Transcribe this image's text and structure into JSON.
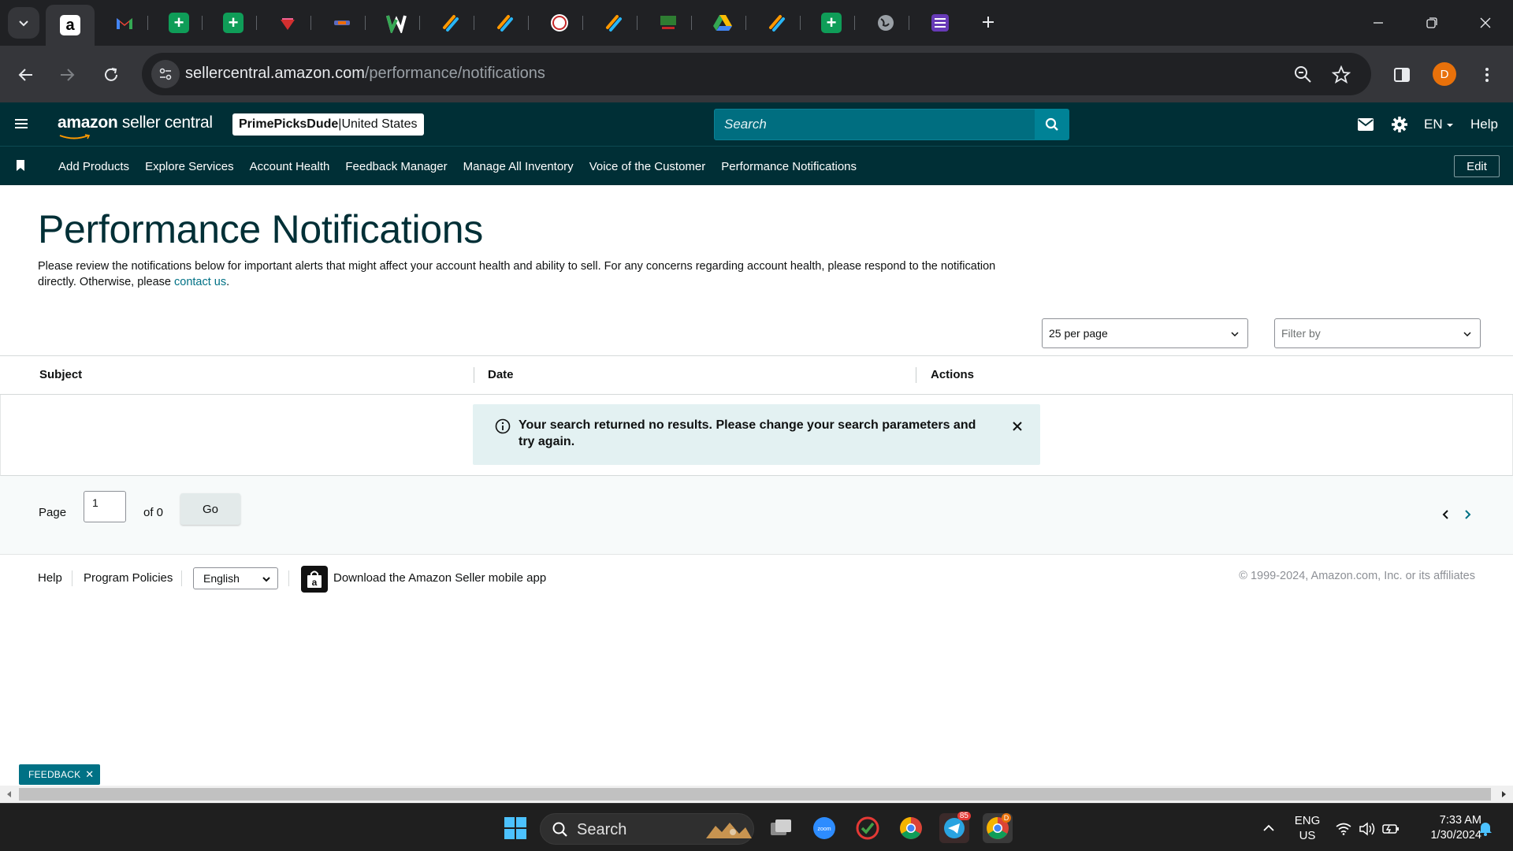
{
  "browser": {
    "url_host": "sellercentral.amazon.com",
    "url_path": "/performance/notifications",
    "profile_initial": "D",
    "tabs": [
      {
        "icon": "amazon-icon",
        "active": true
      },
      {
        "icon": "gmail-icon"
      },
      {
        "icon": "sheets-icon"
      },
      {
        "icon": "sheets-icon"
      },
      {
        "icon": "red-logo-icon"
      },
      {
        "icon": "purple-logo-icon"
      },
      {
        "icon": "w-logo-icon"
      },
      {
        "icon": "orange-stripes-icon"
      },
      {
        "icon": "orange-stripes-icon"
      },
      {
        "icon": "round-logo-icon"
      },
      {
        "icon": "orange-stripes-icon"
      },
      {
        "icon": "us-foods-icon"
      },
      {
        "icon": "drive-icon"
      },
      {
        "icon": "orange-stripes-icon"
      },
      {
        "icon": "sheets-icon"
      },
      {
        "icon": "globe-icon"
      },
      {
        "icon": "list-icon"
      }
    ]
  },
  "header": {
    "logo_bold": "amazon",
    "logo_rest": " seller central",
    "store_name": "PrimePicksDude",
    "store_sep": " | ",
    "store_region": "United States",
    "search_placeholder": "Search",
    "language": "EN",
    "help": "Help"
  },
  "nav": {
    "links": [
      "Add Products",
      "Explore Services",
      "Account Health",
      "Feedback Manager",
      "Manage All Inventory",
      "Voice of the Customer",
      "Performance Notifications"
    ],
    "edit": "Edit"
  },
  "main": {
    "title": "Performance Notifications",
    "description": "Please review the notifications below for important alerts that might affect your account health and ability to sell. For any concerns regarding account health, please respond to the notification directly. Otherwise, please ",
    "contact_link": "contact us",
    "description_end": ".",
    "per_page": "25 per page",
    "filter_placeholder": "Filter by",
    "columns": [
      "Subject",
      "Date",
      "Actions"
    ],
    "alert": "Your search returned no results. Please change your search parameters and try again.",
    "page_label": "Page",
    "page_value": "1",
    "page_of": "of 0",
    "go": "Go"
  },
  "footer": {
    "help": "Help",
    "program_policies": "Program Policies",
    "language": "English",
    "download_app": "Download the Amazon Seller mobile app",
    "copyright": "© 1999-2024, Amazon.com, Inc. or its affiliates",
    "feedback": "FEEDBACK"
  },
  "taskbar": {
    "search": "Search",
    "lang_top": "ENG",
    "lang_bottom": "US",
    "time": "7:33 AM",
    "date": "1/30/2024",
    "telegram_badge": "85",
    "chrome_badge": "D"
  },
  "colors": {
    "header_bg": "#002f36",
    "link": "#007185",
    "alert_bg": "#e3f1f2",
    "search_bg": "#006e80"
  }
}
